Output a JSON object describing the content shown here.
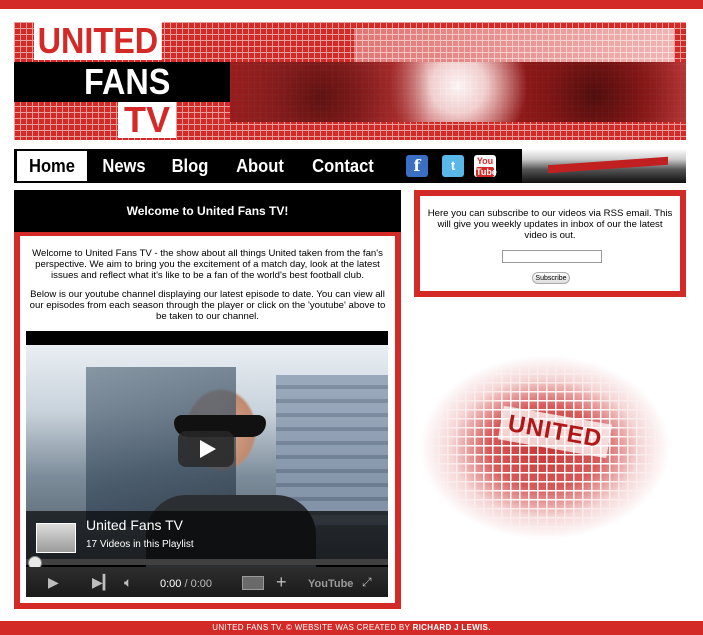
{
  "header": {
    "logo_line1": "UNITED",
    "logo_line2": "FANS",
    "logo_line3": "TV"
  },
  "nav": {
    "items": [
      {
        "label": "Home",
        "active": true
      },
      {
        "label": "News"
      },
      {
        "label": "Blog"
      },
      {
        "label": "About"
      },
      {
        "label": "Contact"
      }
    ],
    "social": {
      "facebook": "f",
      "twitter": "t",
      "youtube_top": "You",
      "youtube_bottom": "Tube"
    }
  },
  "main": {
    "heading": "Welcome to United Fans TV!",
    "paragraph1": "Welcome to United Fans TV - the show about all things United taken from the fan's perspective. We aim to bring you the excitement of a match day, look at the latest issues and reflect what it's like to be a fan of the world's best football club.",
    "paragraph2": "Below is our youtube channel displaying our latest episode to date. You can view all our episodes from each season through the player or click on the 'youtube' above to be taken to our channel.",
    "player": {
      "playlist_title": "United Fans TV",
      "playlist_subtitle": "17 Videos in this Playlist",
      "time_current": "0:00",
      "time_separator": " / ",
      "time_duration": "0:00",
      "youtube_label": "YouTube",
      "progress": 0
    }
  },
  "subscribe": {
    "text": "Here you can subscribe to our videos via RSS email. This will give you weekly updates in inbox of our the latest video is out.",
    "email_value": "",
    "button_label": "Subscribe"
  },
  "decor": {
    "banner_text": "UNITED"
  },
  "footer": {
    "text_prefix": "UNITED FANS TV. © WEBSITE WAS CREATED BY ",
    "author": "RICHARD J LEWIS."
  },
  "colors": {
    "brand_red": "#d32a27",
    "nav_black": "#000000"
  }
}
